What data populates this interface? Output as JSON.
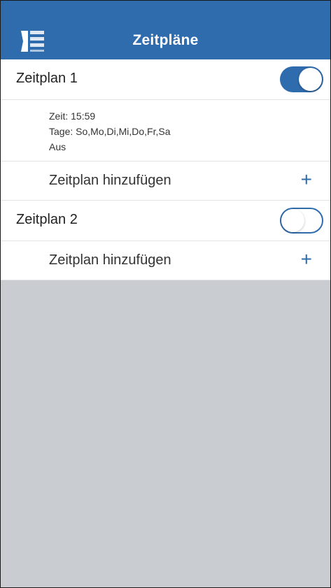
{
  "header": {
    "title": "Zeitpläne",
    "menu_icon": "menu-lines-icon"
  },
  "schedules": [
    {
      "label": "Zeitplan 1",
      "enabled": true,
      "details": {
        "time": "Zeit: 15:59",
        "days": "Tage: So,Mo,Di,Mi,Do,Fr,Sa",
        "action": "Aus"
      },
      "add_label": "Zeitplan hinzufügen"
    },
    {
      "label": "Zeitplan 2",
      "enabled": false,
      "add_label": "Zeitplan hinzufügen"
    }
  ],
  "colors": {
    "accent": "#2f6cae",
    "background": "#c9ccd0"
  }
}
